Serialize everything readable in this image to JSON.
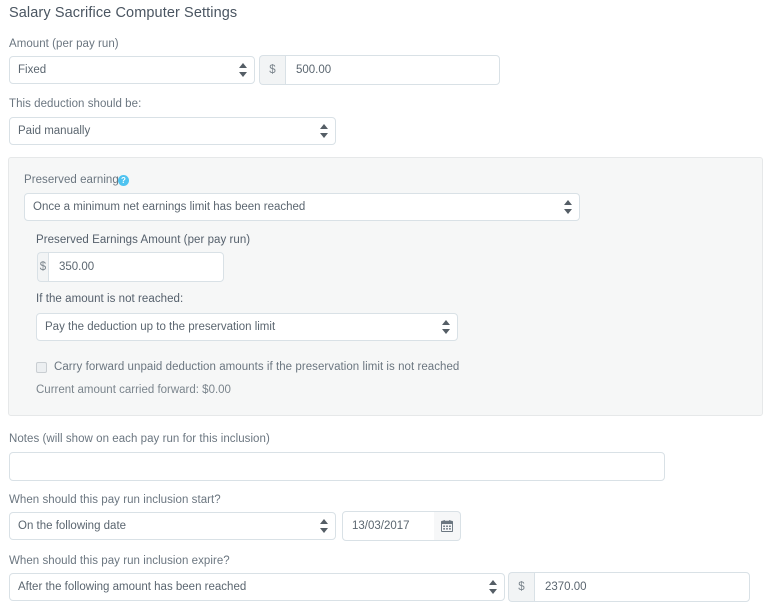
{
  "page": {
    "title": "Salary Sacrifice Computer Settings"
  },
  "amount": {
    "label": "Amount (per pay run)",
    "type_value": "Fixed",
    "currency_symbol": "$",
    "value": "500.00"
  },
  "deduction": {
    "label": "This deduction should be:",
    "value": "Paid manually"
  },
  "preserved": {
    "label": "Preserved earnings",
    "help_icon": "question-mark-circle-icon",
    "help_glyph": "?",
    "mode_value": "Once a minimum net earnings limit has been reached",
    "amount_label": "Preserved Earnings Amount (per pay run)",
    "currency_symbol": "$",
    "amount_value": "350.00",
    "not_reached_label": "If the amount is not reached:",
    "not_reached_value": "Pay the deduction up to the preservation limit",
    "carry_forward_label": "Carry forward unpaid deduction amounts if the preservation limit is not reached",
    "carry_forward_checked": false,
    "current_carried_text": "Current amount carried forward: $0.00"
  },
  "notes": {
    "label": "Notes (will show on each pay run for this inclusion)",
    "value": "",
    "placeholder": ""
  },
  "start": {
    "label": "When should this pay run inclusion start?",
    "mode_value": "On the following date",
    "date_value": "13/03/2017",
    "calendar_icon": "calendar-icon"
  },
  "expire": {
    "label": "When should this pay run inclusion expire?",
    "mode_value": "After the following amount has been reached",
    "currency_symbol": "$",
    "amount_value": "2370.00"
  },
  "colors": {
    "title": "#4a5561",
    "label": "#6b7680",
    "border": "#d9e1e6",
    "panel_bg": "#f6f7f7",
    "help_blue": "#4fc3f0",
    "addon_bg": "#f2f4f5"
  }
}
